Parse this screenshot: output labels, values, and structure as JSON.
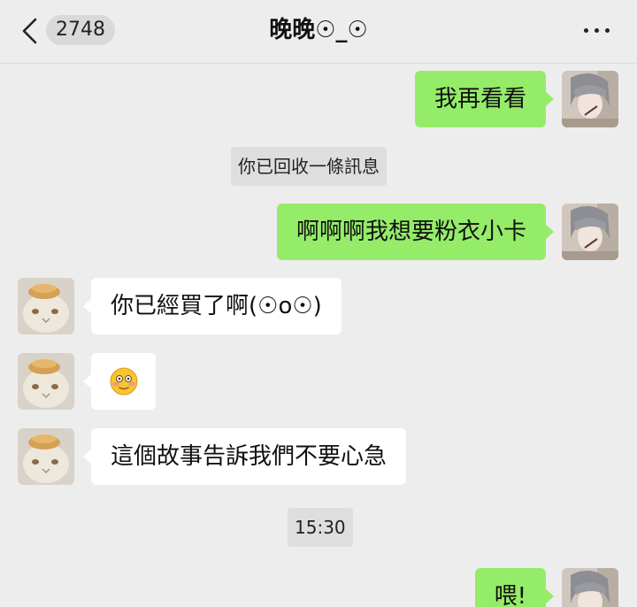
{
  "header": {
    "back_icon": "chevron-left-icon",
    "unread_count": "2748",
    "title": "晚晚☉_☉",
    "more_icon": "more-dots-icon"
  },
  "messages": [
    {
      "side": "self",
      "text": "我再看看"
    },
    {
      "type": "system",
      "text": "你已回收一條訊息"
    },
    {
      "side": "self",
      "text": "啊啊啊我想要粉衣小卡"
    },
    {
      "side": "other",
      "text": "你已經買了啊(☉o☉)"
    },
    {
      "side": "other",
      "emoji": "flushed-smiley-icon"
    },
    {
      "side": "other",
      "text": "這個故事告訴我們不要心急"
    },
    {
      "type": "time",
      "text": "15:30"
    },
    {
      "side": "self",
      "text": "喂!"
    }
  ],
  "colors": {
    "background": "#ededed",
    "self_bubble": "#95ec69",
    "other_bubble": "#ffffff"
  }
}
